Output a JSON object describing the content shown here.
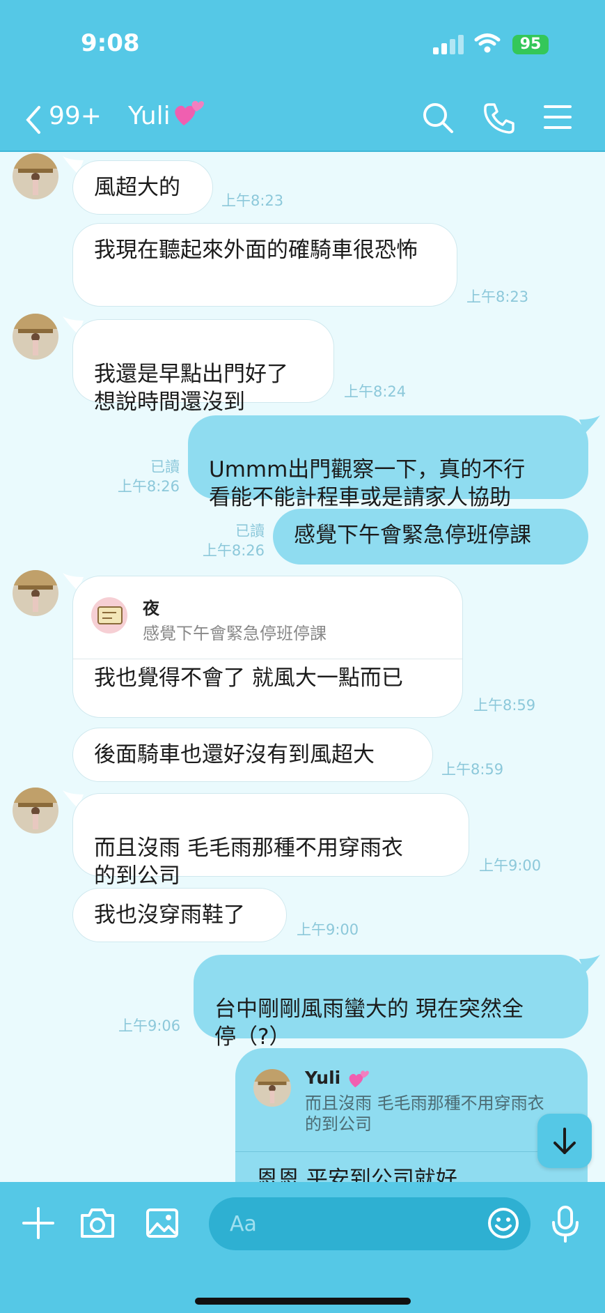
{
  "status_bar": {
    "time": "9:08",
    "battery": "95"
  },
  "header": {
    "unread_count": "99+",
    "title": "Yuli"
  },
  "messages": [
    {
      "text": "風超大的",
      "time": "上午8:23"
    },
    {
      "text": "我現在聽起來外面的確騎車很恐怖",
      "time": "上午8:23"
    },
    {
      "text": "我還是早點出門好了\n想說時間還沒到",
      "time": "上午8:24"
    },
    {
      "text": "Ummm出門觀察一下，真的不行\n看能不能計程車或是請家人協助",
      "time": "上午8:26",
      "read": "已讀"
    },
    {
      "text": "感覺下午會緊急停班停課",
      "time": "上午8:26",
      "read": "已讀"
    },
    {
      "quote_name": "夜",
      "quote_text": "感覺下午會緊急停班停課",
      "text": "我也覺得不會了 就風大一點而已",
      "time": "上午8:59"
    },
    {
      "text": "後面騎車也還好沒有到風超大",
      "time": "上午8:59"
    },
    {
      "text": "而且沒雨  毛毛雨那種不用穿雨衣\n的到公司",
      "time": "上午9:00"
    },
    {
      "text": "我也沒穿雨鞋了",
      "time": "上午9:00"
    },
    {
      "text": "台中剛剛風雨蠻大的 現在突然全\n停（?）",
      "time": "上午9:06"
    },
    {
      "quote_name": "Yuli",
      "quote_text": "而且沒雨 毛毛雨那種不用穿雨衣\n的到公司",
      "text": "恩恩 平安到公司就好"
    }
  ],
  "input": {
    "placeholder": "Aa"
  },
  "colors": {
    "header": "#55c8e6",
    "chat_bg": "#eafafd",
    "outgoing_bubble": "#8fdcf0",
    "incoming_bubble": "#ffffff"
  },
  "icons": [
    "back-icon",
    "search-icon",
    "phone-icon",
    "menu-icon",
    "plus-icon",
    "camera-icon",
    "image-icon",
    "emoji-icon",
    "mic-icon",
    "arrow-down-icon"
  ]
}
